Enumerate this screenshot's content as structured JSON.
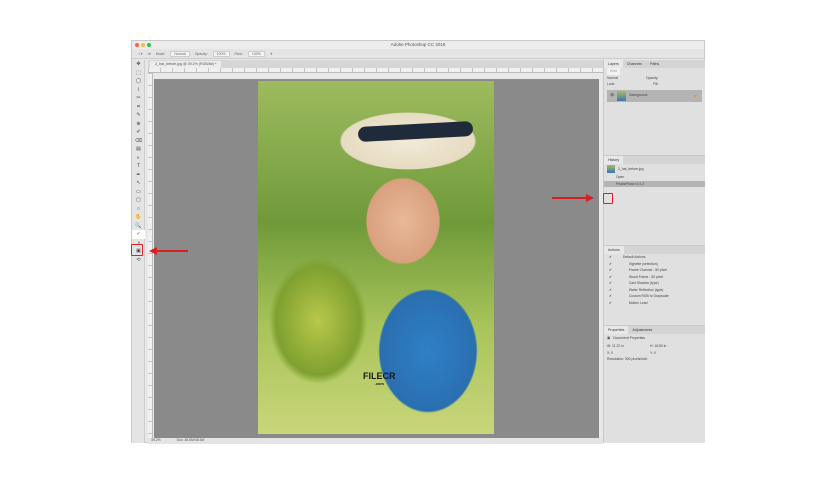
{
  "window": {
    "title": "Adobe Photoshop CC 2018"
  },
  "options": {
    "mode_label": "Mode:",
    "mode": "Normal",
    "opacity_label": "Opacity:",
    "opacity": "100%",
    "flow_label": "Flow:",
    "flow": "100%"
  },
  "document_tab": "2_hat_before.jpg @ 39.2% (RGB/8#) *",
  "tools": [
    "✥",
    "⬚",
    "◯",
    "⌇",
    "✂",
    "⌗",
    "✎",
    "⊕",
    "✐",
    "⌫",
    "▤",
    "◐",
    "T",
    "✒",
    "↖",
    "▭",
    "▢",
    "○",
    "✋",
    "🔍",
    "✓",
    "◑",
    "▣",
    "⟲"
  ],
  "status": {
    "zoom": "39.2%",
    "doc": "Doc: 48.6M/48.6M"
  },
  "watermark": {
    "name": "FILECR",
    "sub": ".com"
  },
  "layers": {
    "tabs": [
      "Layers",
      "Channels",
      "Paths"
    ],
    "kind": "Kind",
    "blend": "Normal",
    "opacity_label": "Opacity:",
    "lock_label": "Lock:",
    "fill_label": "Fill:",
    "layer_name": "Background"
  },
  "history": {
    "title": "History",
    "snapshot": "2_hat_before.jpg",
    "items": [
      "Open",
      "PearlsPhoto r1.0.2"
    ]
  },
  "actions": {
    "title": "Actions",
    "items": [
      "Default Actions",
      "Vignette (selection)",
      "Frame Channel - 50 pixel",
      "Wood Frame - 50 pixel",
      "Cast Shadow (type)",
      "Water Reflection (type)",
      "Custom RGB to Grayscale",
      "Molten Lead"
    ]
  },
  "properties": {
    "tabs": [
      "Properties",
      "Adjustments"
    ],
    "title": "Document Properties",
    "w": "W: 11.22 in",
    "h": "H: 16.83 in",
    "x": "X: 0",
    "y": "Y: 0",
    "resolution": "Resolution: 300 pixels/inch"
  },
  "colors": {
    "highlight": "#e02020"
  }
}
